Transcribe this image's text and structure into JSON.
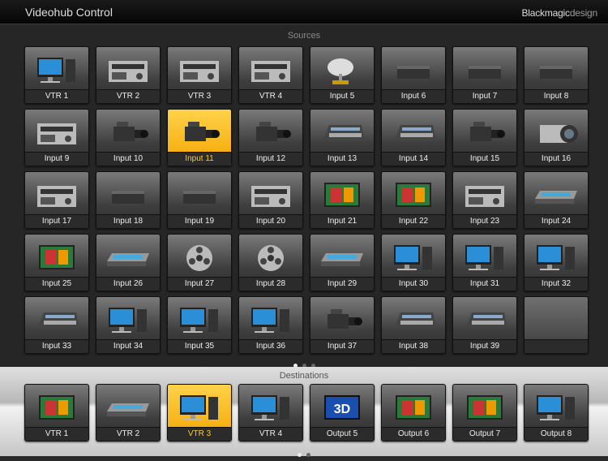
{
  "header": {
    "title": "Videohub Control",
    "brand_bold": "Blackmagic",
    "brand_light": "design"
  },
  "sources": {
    "label": "Sources",
    "selected": "Input 11",
    "pages": 3,
    "current_page": 1,
    "items": [
      {
        "label": "VTR 1",
        "icon": "computer"
      },
      {
        "label": "VTR 2",
        "icon": "deck"
      },
      {
        "label": "VTR 3",
        "icon": "deck"
      },
      {
        "label": "VTR 4",
        "icon": "deck"
      },
      {
        "label": "Input 5",
        "icon": "satellite-dish"
      },
      {
        "label": "Input 6",
        "icon": "converter-box"
      },
      {
        "label": "Input 7",
        "icon": "converter-box"
      },
      {
        "label": "Input 8",
        "icon": "converter-box"
      },
      {
        "label": "Input 9",
        "icon": "deck"
      },
      {
        "label": "Input 10",
        "icon": "camera"
      },
      {
        "label": "Input 11",
        "icon": "camera"
      },
      {
        "label": "Input 12",
        "icon": "camera"
      },
      {
        "label": "Input 13",
        "icon": "switcher"
      },
      {
        "label": "Input 14",
        "icon": "switcher"
      },
      {
        "label": "Input 15",
        "icon": "camera"
      },
      {
        "label": "Input 16",
        "icon": "lens"
      },
      {
        "label": "Input 17",
        "icon": "deck"
      },
      {
        "label": "Input 18",
        "icon": "converter-box"
      },
      {
        "label": "Input 19",
        "icon": "converter-box"
      },
      {
        "label": "Input 20",
        "icon": "deck"
      },
      {
        "label": "Input 21",
        "icon": "monitor"
      },
      {
        "label": "Input 22",
        "icon": "monitor"
      },
      {
        "label": "Input 23",
        "icon": "deck"
      },
      {
        "label": "Input 24",
        "icon": "rack"
      },
      {
        "label": "Input 25",
        "icon": "monitor"
      },
      {
        "label": "Input 26",
        "icon": "rack"
      },
      {
        "label": "Input 27",
        "icon": "film-reel"
      },
      {
        "label": "Input 28",
        "icon": "film-reel"
      },
      {
        "label": "Input 29",
        "icon": "rack"
      },
      {
        "label": "Input 30",
        "icon": "computer"
      },
      {
        "label": "Input 31",
        "icon": "computer"
      },
      {
        "label": "Input 32",
        "icon": "computer"
      },
      {
        "label": "Input 33",
        "icon": "switcher"
      },
      {
        "label": "Input 34",
        "icon": "computer"
      },
      {
        "label": "Input 35",
        "icon": "computer"
      },
      {
        "label": "Input 36",
        "icon": "computer"
      },
      {
        "label": "Input 37",
        "icon": "camera"
      },
      {
        "label": "Input 38",
        "icon": "switcher"
      },
      {
        "label": "Input 39",
        "icon": "switcher"
      },
      {
        "label": "",
        "icon": ""
      }
    ]
  },
  "destinations": {
    "label": "Destinations",
    "selected": "VTR 3",
    "pages": 2,
    "current_page": 1,
    "items": [
      {
        "label": "VTR 1",
        "icon": "monitor"
      },
      {
        "label": "VTR 2",
        "icon": "rack"
      },
      {
        "label": "VTR 3",
        "icon": "computer"
      },
      {
        "label": "VTR 4",
        "icon": "computer"
      },
      {
        "label": "Output 5",
        "icon": "monitor-3d"
      },
      {
        "label": "Output 6",
        "icon": "monitor"
      },
      {
        "label": "Output 7",
        "icon": "monitor"
      },
      {
        "label": "Output 8",
        "icon": "computer"
      }
    ]
  },
  "icon_3d_text": "3D"
}
